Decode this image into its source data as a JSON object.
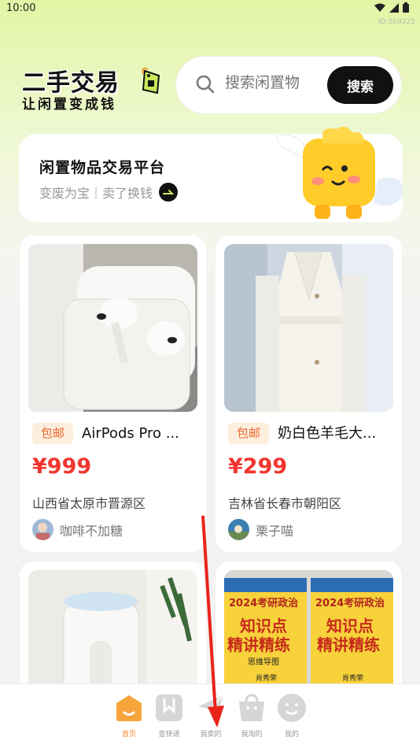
{
  "status_bar": {
    "time": "10:00",
    "device_id": "ID:5b9225"
  },
  "header": {
    "logo_title": "二手交易",
    "logo_subtitle": "让闲置变成钱",
    "search_placeholder": "搜索闲置物",
    "search_button": "搜索"
  },
  "banner": {
    "title": "闲置物品交易平台",
    "subtitle": "变废为宝｜卖了换钱"
  },
  "products": [
    {
      "badge": "包邮",
      "title": "AirPods Pro ...",
      "price": "¥999",
      "location": "山西省太原市晋源区",
      "seller": "咖啡不加糖"
    },
    {
      "badge": "包邮",
      "title": "奶白色羊毛大...",
      "price": "¥299",
      "location": "吉林省长春市朝阳区",
      "seller": "栗子喵"
    }
  ],
  "book_cover": {
    "year_label": "2024考研政治",
    "line1": "知识点",
    "line2": "精讲精练",
    "author": "肖秀荣",
    "sub": "思维导图"
  },
  "tabs": [
    {
      "label": "首页",
      "icon": "home-icon",
      "active": true
    },
    {
      "label": "查快递",
      "icon": "bookmark-icon",
      "active": false
    },
    {
      "label": "我卖的",
      "icon": "send-icon",
      "active": false
    },
    {
      "label": "我淘的",
      "icon": "shopping-bag-icon",
      "active": false
    },
    {
      "label": "我的",
      "icon": "smile-icon",
      "active": false
    }
  ],
  "colors": {
    "accent": "#f0352f",
    "brand_green": "#e3f4a4",
    "tab_active": "#f0892b"
  }
}
